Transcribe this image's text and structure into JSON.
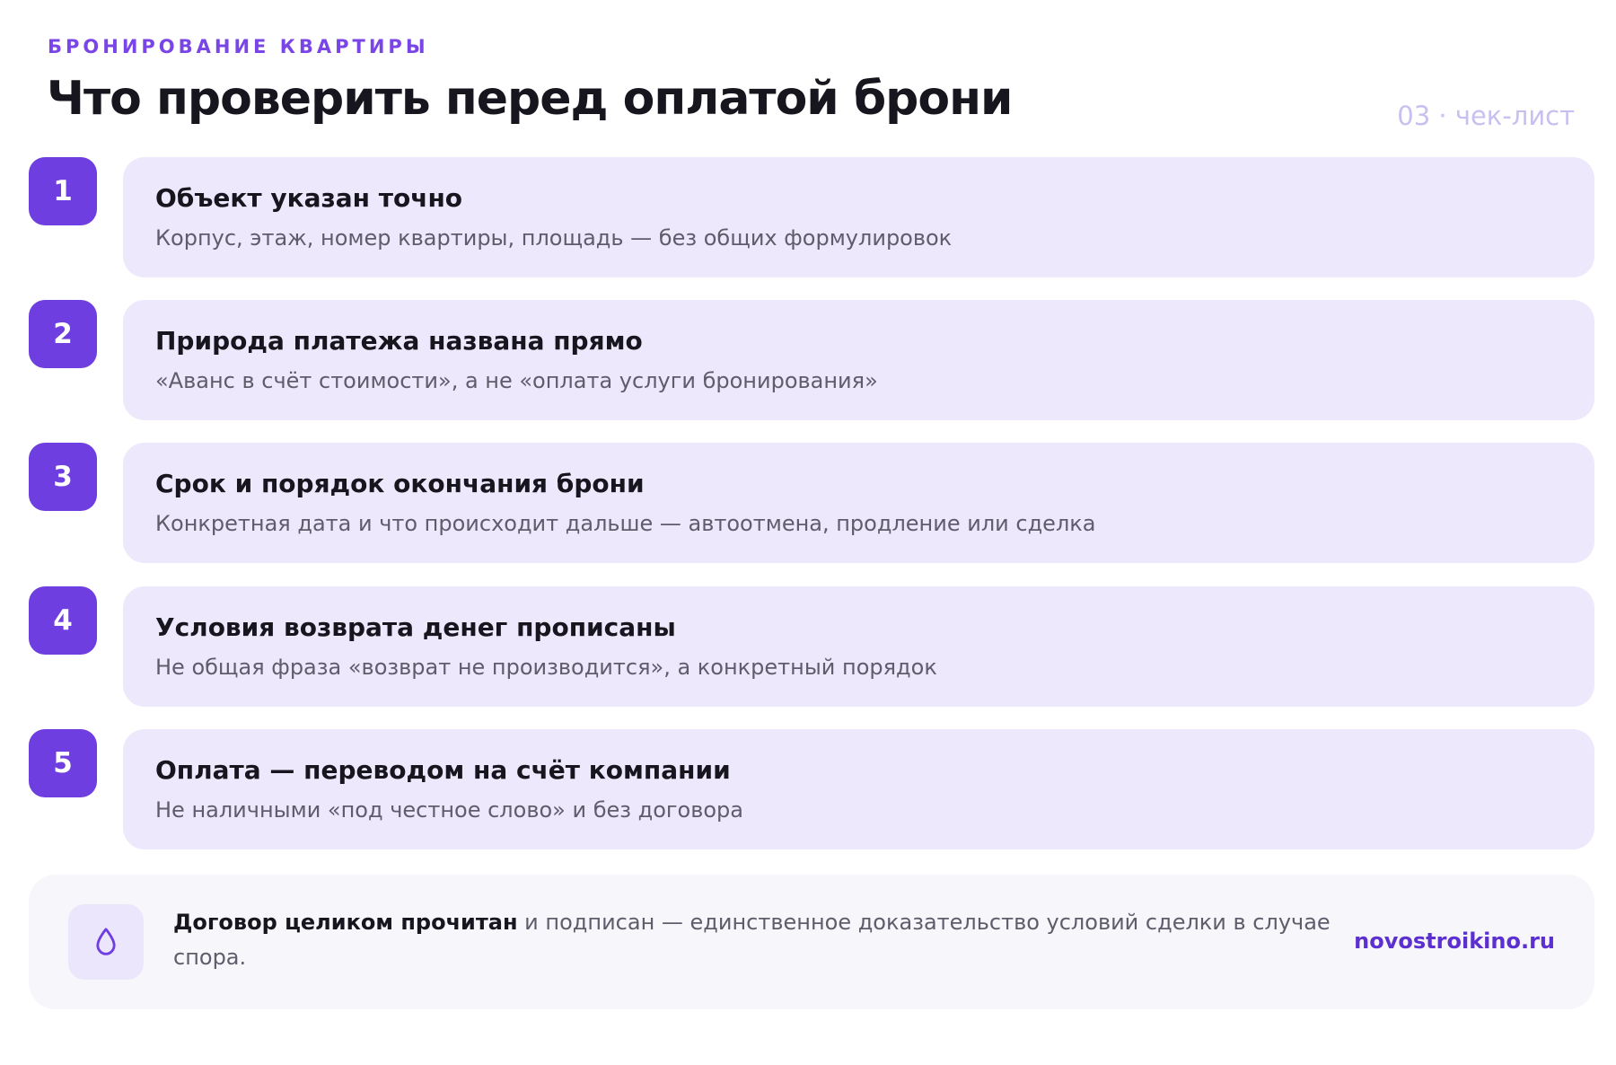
{
  "header": {
    "eyebrow": "БРОНИРОВАНИЕ КВАРТИРЫ",
    "title": "Что проверить перед оплатой брони",
    "meta": "03 · чек-лист"
  },
  "steps": [
    {
      "number": "1",
      "title": "Объект указан точно",
      "description": "Корпус, этаж, номер квартиры, площадь — без общих формулировок"
    },
    {
      "number": "2",
      "title": "Природа платежа названа прямо",
      "description": "«Аванс в счёт стоимости», а не «оплата услуги бронирования»"
    },
    {
      "number": "3",
      "title": "Срок и порядок окончания брони",
      "description": "Конкретная дата и что происходит дальше — автоотмена, продление или сделка"
    },
    {
      "number": "4",
      "title": "Условия возврата денег прописаны",
      "description": "Не общая фраза «возврат не производится», а конкретный порядок"
    },
    {
      "number": "5",
      "title": "Оплата — переводом на счёт компании",
      "description": "Не наличными «под честное слово» и без договора"
    }
  ],
  "note": {
    "icon": "drop-icon",
    "bold": "Договор целиком прочитан",
    "text": " и подписан — единственное доказательство условий сделки в случае спора.",
    "site": "novostroikino.ru"
  },
  "colors": {
    "accent": "#6e3ee0",
    "card_bg": "#ede8fc",
    "note_bg": "#f7f6fa",
    "muted": "#c9bff0"
  }
}
